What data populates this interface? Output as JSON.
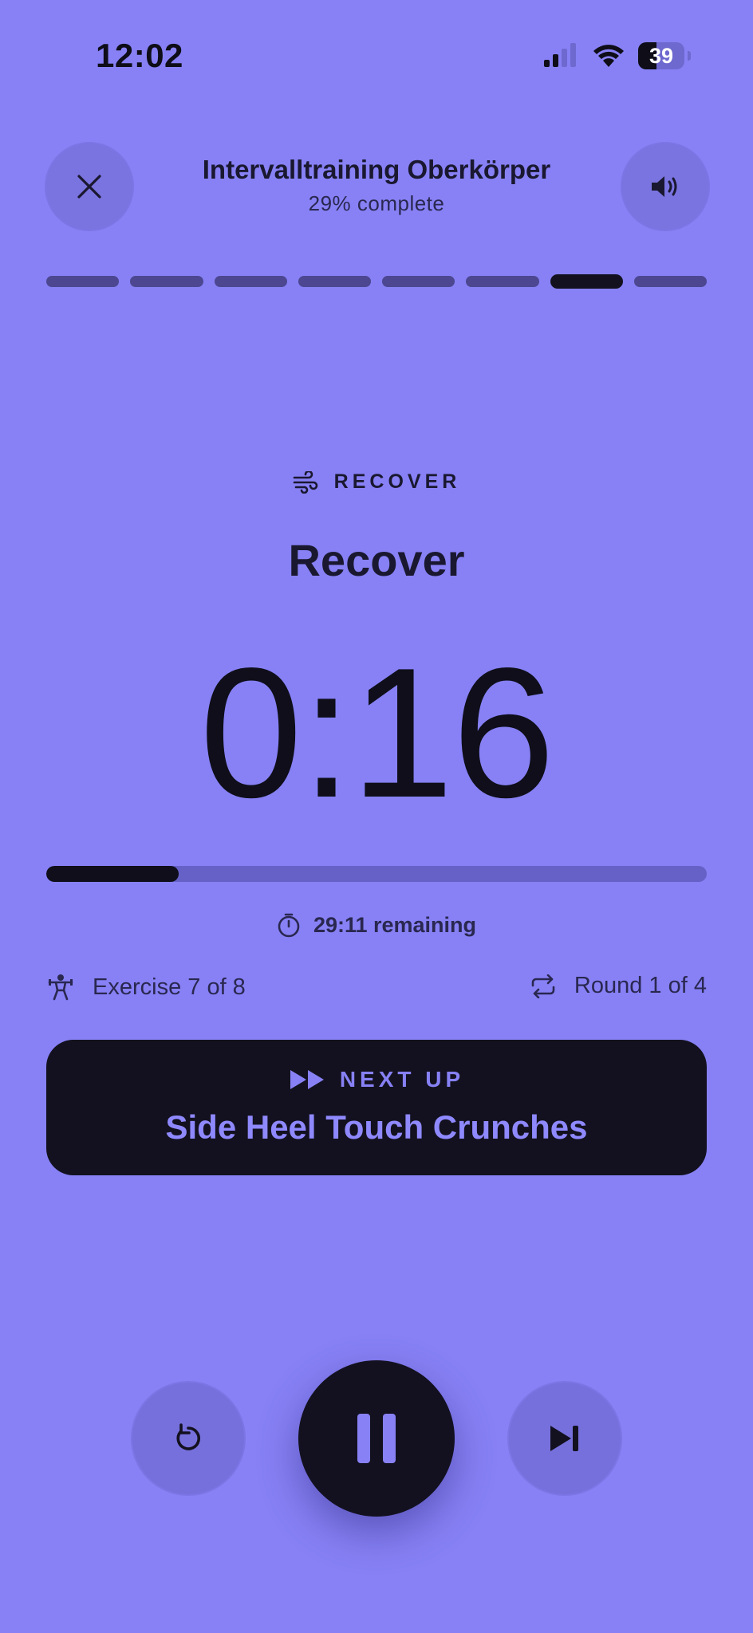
{
  "status_bar": {
    "time": "12:02",
    "battery_level": "39",
    "battery_fraction": 0.39,
    "icons": [
      "cellular-signal-icon",
      "wifi-icon",
      "battery-icon"
    ]
  },
  "header": {
    "title": "Intervalltraining Oberkörper",
    "progress_text": "29% complete",
    "close_icon": "close-icon",
    "sound_icon": "speaker-icon"
  },
  "segments": {
    "total": 8,
    "active_index": 6
  },
  "phase": {
    "icon": "wind-icon",
    "label": "RECOVER",
    "title": "Recover"
  },
  "timer": {
    "value": "0:16",
    "progress_fraction": 0.2,
    "remaining_icon": "stopwatch-icon",
    "remaining_text": "29:11 remaining"
  },
  "info": {
    "exercise_icon": "weightlifter-icon",
    "exercise_text": "Exercise 7 of 8",
    "round_icon": "repeat-icon",
    "round_text": "Round 1 of 4"
  },
  "next_up": {
    "icon": "fast-forward-icon",
    "label": "NEXT UP",
    "name": "Side Heel Touch Crunches"
  },
  "controls": {
    "restart_icon": "restart-icon",
    "pause_icon": "pause-icon",
    "skip_icon": "skip-next-icon"
  },
  "colors": {
    "background": "#8781f5",
    "dark": "#13111f",
    "accent_text": "#8f89ff"
  }
}
